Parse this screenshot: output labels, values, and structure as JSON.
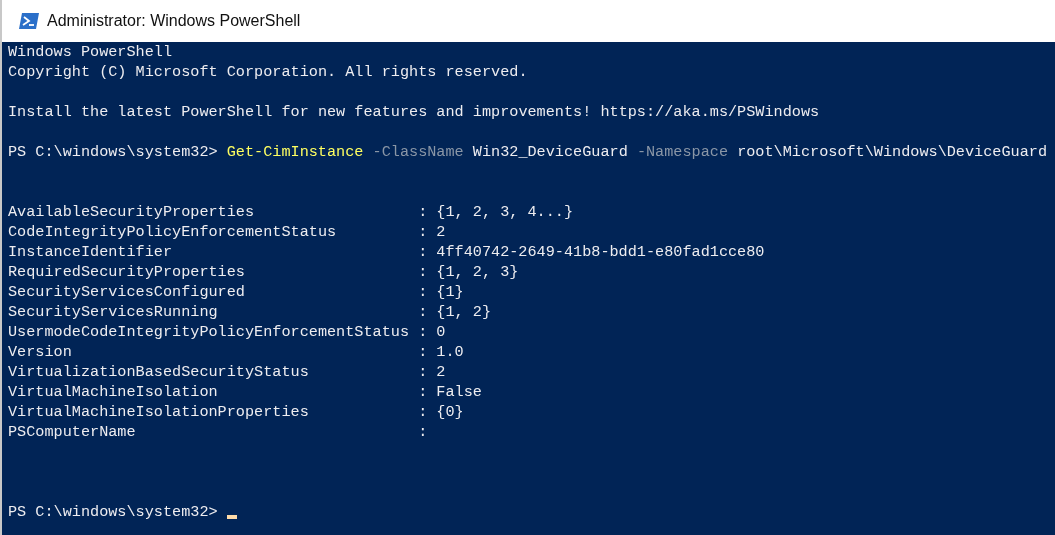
{
  "window": {
    "title": "Administrator: Windows PowerShell"
  },
  "banner": [
    "Windows PowerShell",
    "Copyright (C) Microsoft Corporation. All rights reserved."
  ],
  "notice": "Install the latest PowerShell for new features and improvements! https://aka.ms/PSWindows",
  "command": {
    "prompt": "PS C:\\windows\\system32>",
    "segments": [
      {
        "kind": "cmdlet",
        "text": "Get-CimInstance"
      },
      {
        "kind": "parameter",
        "text": "-ClassName"
      },
      {
        "kind": "argument",
        "text": "Win32_DeviceGuard"
      },
      {
        "kind": "parameter",
        "text": "-Namespace"
      },
      {
        "kind": "argument",
        "text": "root\\Microsoft\\Windows\\DeviceGuard"
      }
    ]
  },
  "results": [
    {
      "name": "AvailableSecurityProperties",
      "separator": ":",
      "value": "{1, 2, 3, 4...}"
    },
    {
      "name": "CodeIntegrityPolicyEnforcementStatus",
      "separator": ":",
      "value": "2"
    },
    {
      "name": "InstanceIdentifier",
      "separator": ":",
      "value": "4ff40742-2649-41b8-bdd1-e80fad1cce80"
    },
    {
      "name": "RequiredSecurityProperties",
      "separator": ":",
      "value": "{1, 2, 3}"
    },
    {
      "name": "SecurityServicesConfigured",
      "separator": ":",
      "value": "{1}"
    },
    {
      "name": "SecurityServicesRunning",
      "separator": ":",
      "value": "{1, 2}"
    },
    {
      "name": "UsermodeCodeIntegrityPolicyEnforcementStatus",
      "separator": ":",
      "value": "0"
    },
    {
      "name": "Version",
      "separator": ":",
      "value": "1.0"
    },
    {
      "name": "VirtualizationBasedSecurityStatus",
      "separator": ":",
      "value": "2"
    },
    {
      "name": "VirtualMachineIsolation",
      "separator": ":",
      "value": "False"
    },
    {
      "name": "VirtualMachineIsolationProperties",
      "separator": ":",
      "value": "{0}"
    },
    {
      "name": "PSComputerName",
      "separator": ":"
    }
  ],
  "final_prompt": {
    "prompt": "PS C:\\windows\\system32>"
  }
}
